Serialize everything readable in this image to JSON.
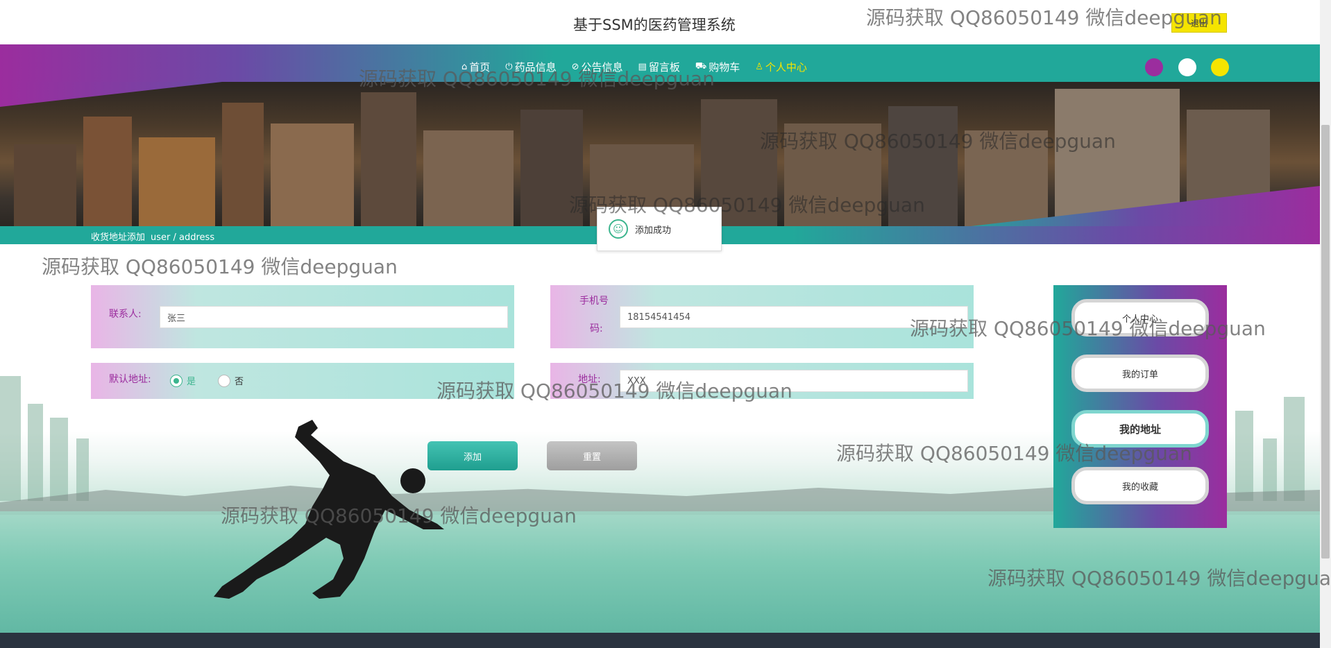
{
  "header": {
    "site_title": "基于SSM的医药管理系统",
    "logout_label": "退出"
  },
  "nav": {
    "items": [
      {
        "label": "首页",
        "icon": "home-icon"
      },
      {
        "label": "药品信息",
        "icon": "power-icon"
      },
      {
        "label": "公告信息",
        "icon": "tag-icon"
      },
      {
        "label": "留言板",
        "icon": "clipboard-icon"
      },
      {
        "label": "购物车",
        "icon": "cart-icon"
      },
      {
        "label": "个人中心",
        "icon": "user-icon"
      }
    ],
    "active_index": 5,
    "theme_colors": [
      "#9b2d9e",
      "#ffffff",
      "#f5e400"
    ]
  },
  "breadcrumb": {
    "title": "收货地址添加",
    "path": "user / address"
  },
  "toast": {
    "message": "添加成功"
  },
  "form": {
    "contact_label": "联系人:",
    "contact_value": "张三",
    "phone_label_line1": "手机号",
    "phone_label_line2": "码:",
    "phone_value": "18154541454",
    "default_label": "默认地址:",
    "default_yes": "是",
    "default_no": "否",
    "default_selected": "是",
    "address_label": "地址:",
    "address_value": "XXX",
    "add_button": "添加",
    "reset_button": "重置"
  },
  "side_menu": {
    "items": [
      "个人中心",
      "我的订单",
      "我的地址",
      "我的收藏"
    ],
    "active_index": 2
  },
  "watermark": "源码获取 QQ86050149 微信deepguan"
}
